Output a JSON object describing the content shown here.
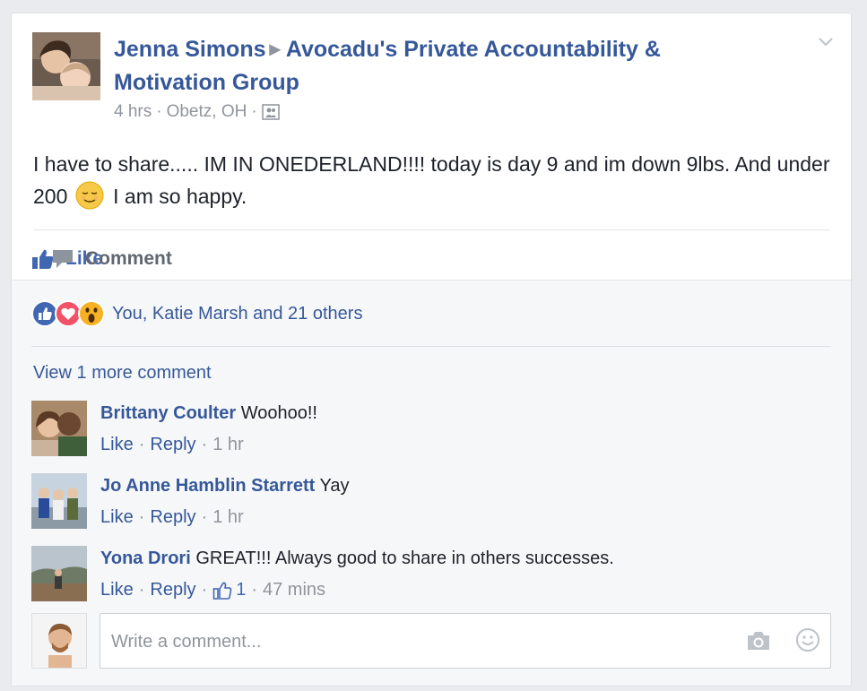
{
  "post": {
    "author": "Jenna Simons",
    "group": "Avocadu's Private Accountability & Motivation Group",
    "time": "4 hrs",
    "location": "Obetz, OH",
    "dot": "·",
    "text_part1": "I have to share..... IM IN ONEDERLAND!!!! today is day 9 and im down 9lbs. And under 200",
    "text_part2": "I am so happy.",
    "icons": {
      "menu": "chevron-down-icon",
      "audience": "group-audience-icon",
      "emoji": "relieved-face-emoji"
    }
  },
  "actions": {
    "like": "Like",
    "comment": "Comment"
  },
  "reactions": {
    "summary": "You, Katie Marsh and 21 others",
    "types": [
      "like",
      "love",
      "wow"
    ],
    "colors": {
      "like": "#4267b2",
      "love": "#f25268",
      "wow": "#f7b125"
    }
  },
  "view_more": "View 1 more comment",
  "comments": [
    {
      "name": "Brittany Coulter",
      "text": "Woohoo!!",
      "like": "Like",
      "reply": "Reply",
      "time": "1 hr",
      "likes": ""
    },
    {
      "name": "Jo Anne Hamblin Starrett",
      "text": "Yay",
      "like": "Like",
      "reply": "Reply",
      "time": "1 hr",
      "likes": ""
    },
    {
      "name": "Yona Drori",
      "text": "GREAT!!! Always good to share in others successes.",
      "like": "Like",
      "reply": "Reply",
      "time": "47 mins",
      "likes": "1"
    }
  ],
  "composer": {
    "placeholder": "Write a comment..."
  },
  "colors": {
    "link": "#365899",
    "accent": "#4267b2",
    "muted": "#90949c",
    "background": "#e9ebee"
  }
}
